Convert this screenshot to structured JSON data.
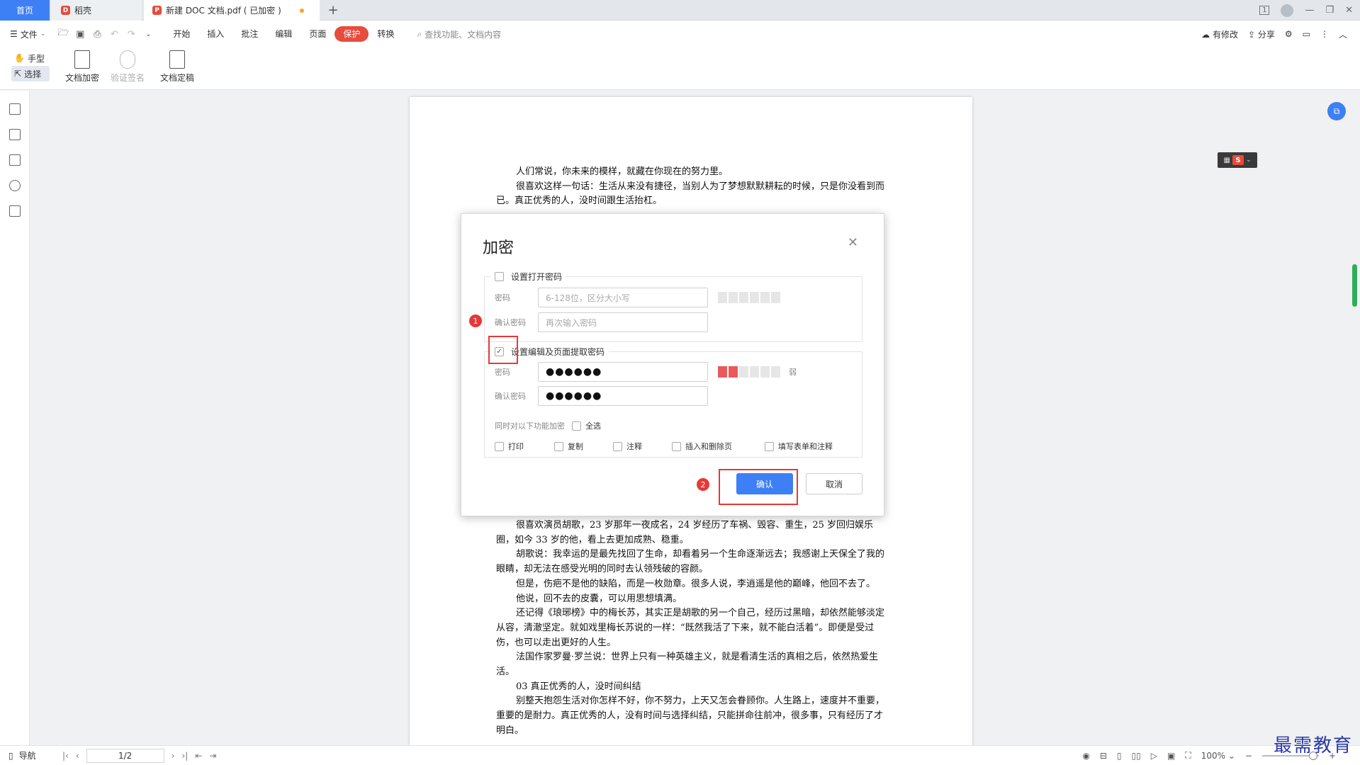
{
  "tabs": {
    "home": "首页",
    "wk": "稻壳",
    "doc": "新建 DOC 文档.pdf ( 已加密 )",
    "add": "+"
  },
  "window": {
    "page_indicator": "1"
  },
  "menu": {
    "file": "文件",
    "tabs": [
      "开始",
      "插入",
      "批注",
      "编辑",
      "页面",
      "保护",
      "转换"
    ],
    "active_tab": "保护",
    "search_placeholder": "查找功能、文档内容",
    "right": {
      "modified": "有修改",
      "share": "分享"
    }
  },
  "ribbon": {
    "hand": "手型",
    "select": "选择",
    "encrypt": "文档加密",
    "verify_sign": "验证签名",
    "finalize": "文档定稿"
  },
  "document": {
    "paragraphs_top": [
      "人们常说，你未来的模样，就藏在你现在的努力里。",
      "很喜欢这样一句话：生活从来没有捷径，当别人为了梦想默默耕耘的时候，只是你没看到而已。真正优秀的人，没时间跟生活抬杠。"
    ],
    "paragraphs_bottom": [
      "很喜欢演员胡歌，23 岁那年一夜成名，24 岁经历了车祸、毁容、重生，25 岁回归娱乐圈，如今 33 岁的他，看上去更加成熟、稳重。",
      "胡歌说：我幸运的是最先找回了生命，却看着另一个生命逐渐远去；我感谢上天保全了我的眼睛，却无法在感受光明的同时去认领残破的容颜。",
      "但是，伤疤不是他的缺陷，而是一枚勋章。很多人说，李逍遥是他的巅峰，他回不去了。",
      "他说，回不去的皮囊，可以用思想填满。",
      "还记得《琅琊榜》中的梅长苏，其实正是胡歌的另一个自己，经历过黑暗，却依然能够淡定从容，清澈坚定。就如戏里梅长苏说的一样：“既然我活了下来，就不能白活着”。即便是受过伤，也可以走出更好的人生。",
      "法国作家罗曼·罗兰说：世界上只有一种英雄主义，就是看清生活的真相之后，依然热爱生活。",
      "03 真正优秀的人，没时间纠结",
      "别整天抱怨生活对你怎样不好，你不努力，上天又怎会眷顾你。人生路上，速度并不重要，重要的是耐力。真正优秀的人，没有时间与选择纠结，只能拼命往前冲，很多事，只有经历了才明白。"
    ]
  },
  "dialog": {
    "title": "加密",
    "open_pw_label": "设置打开密码",
    "open_pw_checked": false,
    "pw_label": "密码",
    "confirm_label": "确认密码",
    "open_pw_placeholder": "6-128位，区分大小写",
    "open_confirm_placeholder": "再次输入密码",
    "edit_pw_label": "设置编辑及页面提取密码",
    "edit_pw_checked": true,
    "edit_pw_value": "●●●●●●",
    "edit_confirm_value": "●●●●●●",
    "strength_word": "弱",
    "strength_level": 2,
    "strength_segments": 6,
    "func_label": "同时对以下功能加密",
    "select_all": "全选",
    "options": [
      "打印",
      "复制",
      "注释",
      "插入和删除页",
      "填写表单和注释"
    ],
    "ok": "确认",
    "cancel": "取消"
  },
  "annotations": {
    "badge1": "1",
    "badge2": "2"
  },
  "statusbar": {
    "nav": "导航",
    "page": "1/2",
    "zoom": "100%",
    "zoom_fraction": 0.85
  },
  "watermark": "最需教育",
  "colors": {
    "accent": "#3d7ff5",
    "protect_tab": "#e74c3c",
    "annotation_red": "#e53935",
    "strength_on": "#e85a5a"
  }
}
